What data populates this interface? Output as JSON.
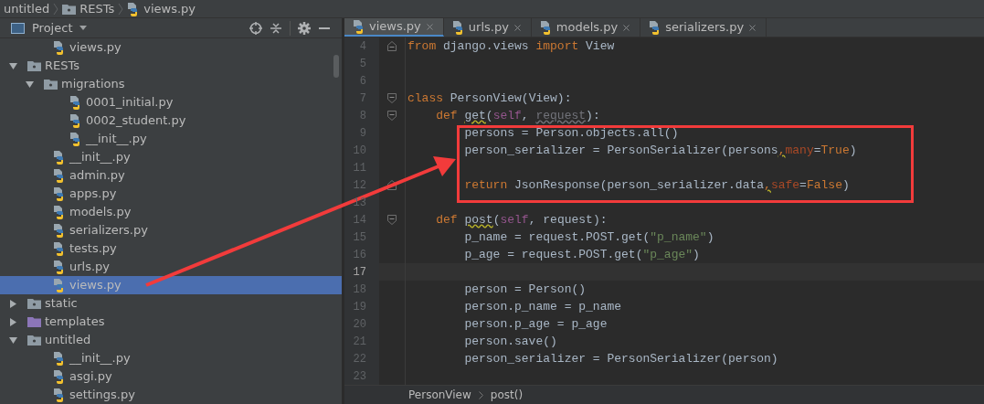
{
  "breadcrumb": [
    {
      "label": "untitled",
      "kind": "package"
    },
    {
      "label": "RESTs",
      "kind": "package"
    },
    {
      "label": "views.py",
      "kind": "file"
    }
  ],
  "project_panel": {
    "title": "Project",
    "tree": {
      "continued": [
        {
          "name": "views.py",
          "kind": "file",
          "selected": false
        }
      ],
      "items": [
        {
          "name": "RESTs",
          "kind": "package",
          "expanded": true,
          "selected": false,
          "children": [
            {
              "name": "migrations",
              "kind": "package",
              "expanded": true,
              "selected": false,
              "children": [
                {
                  "name": "0001_initial.py",
                  "kind": "file",
                  "selected": false
                },
                {
                  "name": "0002_student.py",
                  "kind": "file",
                  "selected": false
                },
                {
                  "name": "__init__.py",
                  "kind": "file",
                  "selected": false
                }
              ]
            },
            {
              "name": "__init__.py",
              "kind": "file",
              "selected": false
            },
            {
              "name": "admin.py",
              "kind": "file",
              "selected": false
            },
            {
              "name": "apps.py",
              "kind": "file",
              "selected": false
            },
            {
              "name": "models.py",
              "kind": "file",
              "selected": false
            },
            {
              "name": "serializers.py",
              "kind": "file",
              "selected": false
            },
            {
              "name": "tests.py",
              "kind": "file",
              "selected": false
            },
            {
              "name": "urls.py",
              "kind": "file",
              "selected": false
            },
            {
              "name": "views.py",
              "kind": "file",
              "selected": true
            }
          ]
        },
        {
          "name": "static",
          "kind": "package",
          "expanded": false,
          "selected": false
        },
        {
          "name": "templates",
          "kind": "template_folder",
          "expanded": false,
          "selected": false
        },
        {
          "name": "untitled",
          "kind": "package",
          "expanded": true,
          "selected": false,
          "children": [
            {
              "name": "__init__.py",
              "kind": "file",
              "selected": false
            },
            {
              "name": "asgi.py",
              "kind": "file",
              "selected": false
            },
            {
              "name": "settings.py",
              "kind": "file",
              "selected": false
            }
          ]
        }
      ]
    }
  },
  "tabs": [
    {
      "label": "views.py",
      "selected": true
    },
    {
      "label": "urls.py",
      "selected": false
    },
    {
      "label": "models.py",
      "selected": false
    },
    {
      "label": "serializers.py",
      "selected": false
    }
  ],
  "code_lines": [
    {
      "number": "4",
      "current": false,
      "fold": {
        "kind": "end"
      },
      "tokens": [
        {
          "t": "from",
          "kind": "kw"
        },
        {
          "t": " django.views ",
          "kind": "plain"
        },
        {
          "t": "import",
          "kind": "kw"
        },
        {
          "t": " View",
          "kind": "plain"
        }
      ]
    },
    {
      "number": "5",
      "current": false
    },
    {
      "number": "6",
      "current": false
    },
    {
      "number": "7",
      "current": false,
      "fold": {
        "kind": "start"
      },
      "tokens": [
        {
          "t": "class",
          "kind": "kw"
        },
        {
          "t": " PersonView(View):",
          "kind": "plain"
        }
      ]
    },
    {
      "number": "8",
      "current": false,
      "fold": {
        "kind": "start"
      },
      "tokens": [
        {
          "t": "    def ",
          "kind": "kw"
        },
        {
          "t": "get",
          "kind": "warn"
        },
        {
          "t": "(",
          "kind": "plain"
        },
        {
          "t": "self",
          "kind": "self"
        },
        {
          "t": ", ",
          "kind": "plain"
        },
        {
          "t": "request",
          "kind": "unused"
        },
        {
          "t": "):",
          "kind": "plain"
        }
      ]
    },
    {
      "number": "9",
      "current": false,
      "tokens": [
        {
          "t": "        persons = Person.objects.all()",
          "kind": "plain"
        }
      ]
    },
    {
      "number": "10",
      "current": false,
      "tokens": [
        {
          "t": "        person_serializer = PersonSerializer(persons",
          "kind": "plain"
        },
        {
          "t": ",",
          "kind": "comma_warn"
        },
        {
          "t": "many",
          "kind": "arg"
        },
        {
          "t": "=",
          "kind": "plain"
        },
        {
          "t": "True",
          "kind": "kw"
        },
        {
          "t": ")",
          "kind": "plain"
        }
      ]
    },
    {
      "number": "11",
      "current": false
    },
    {
      "number": "12",
      "current": false,
      "fold": {
        "kind": "end"
      },
      "tokens": [
        {
          "t": "        return",
          "kind": "kw"
        },
        {
          "t": " JsonResponse(person_serializer.data",
          "kind": "plain"
        },
        {
          "t": ",",
          "kind": "comma_warn"
        },
        {
          "t": "safe",
          "kind": "arg"
        },
        {
          "t": "=",
          "kind": "plain"
        },
        {
          "t": "False",
          "kind": "kw"
        },
        {
          "t": ")",
          "kind": "plain"
        }
      ]
    },
    {
      "number": "13",
      "current": false
    },
    {
      "number": "14",
      "current": false,
      "fold": {
        "kind": "start"
      },
      "tokens": [
        {
          "t": "    def ",
          "kind": "kw"
        },
        {
          "t": "post",
          "kind": "warn"
        },
        {
          "t": "(",
          "kind": "plain"
        },
        {
          "t": "self",
          "kind": "self"
        },
        {
          "t": ", request):",
          "kind": "plain"
        }
      ]
    },
    {
      "number": "15",
      "current": false,
      "tokens": [
        {
          "t": "        p_name = request.POST.get(",
          "kind": "plain"
        },
        {
          "t": "\"p_name\"",
          "kind": "str"
        },
        {
          "t": ")",
          "kind": "plain"
        }
      ]
    },
    {
      "number": "16",
      "current": false,
      "tokens": [
        {
          "t": "        p_age = request.POST.get(",
          "kind": "plain"
        },
        {
          "t": "\"p_age\"",
          "kind": "str"
        },
        {
          "t": ")",
          "kind": "plain"
        }
      ]
    },
    {
      "number": "17",
      "current": true
    },
    {
      "number": "18",
      "current": false,
      "tokens": [
        {
          "t": "        person = Person()",
          "kind": "plain"
        }
      ]
    },
    {
      "number": "19",
      "current": false,
      "tokens": [
        {
          "t": "        person.p_name = p_name",
          "kind": "plain"
        }
      ]
    },
    {
      "number": "20",
      "current": false,
      "tokens": [
        {
          "t": "        person.p_age = p_age",
          "kind": "plain"
        }
      ]
    },
    {
      "number": "21",
      "current": false,
      "tokens": [
        {
          "t": "        person.save()",
          "kind": "plain"
        }
      ]
    },
    {
      "number": "22",
      "current": false,
      "tokens": [
        {
          "t": "        person_serializer = PersonSerializer(person)",
          "kind": "plain"
        }
      ]
    },
    {
      "number": "23",
      "current": false
    }
  ],
  "editor_breadcrumb": [
    "PersonView",
    "post()"
  ]
}
